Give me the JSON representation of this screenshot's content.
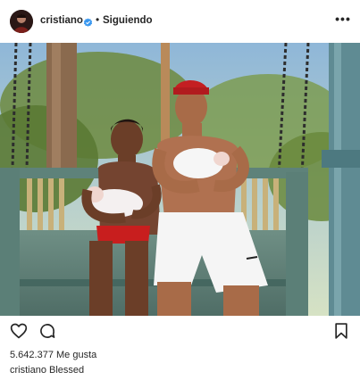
{
  "header": {
    "username": "cristiano",
    "separator": "•",
    "follow_status": "Siguiendo",
    "more_symbol": "•••"
  },
  "icons": {
    "verified": "verified-badge-icon",
    "more": "more-options-icon",
    "like": "heart-icon",
    "comment": "comment-icon",
    "save": "bookmark-icon"
  },
  "colors": {
    "verified": "#3897f0",
    "text": "#262626"
  },
  "post": {
    "likes_count": "5.642.377",
    "likes_label": "Me gusta",
    "caption_user": "cristiano",
    "caption_text": "Blessed"
  }
}
